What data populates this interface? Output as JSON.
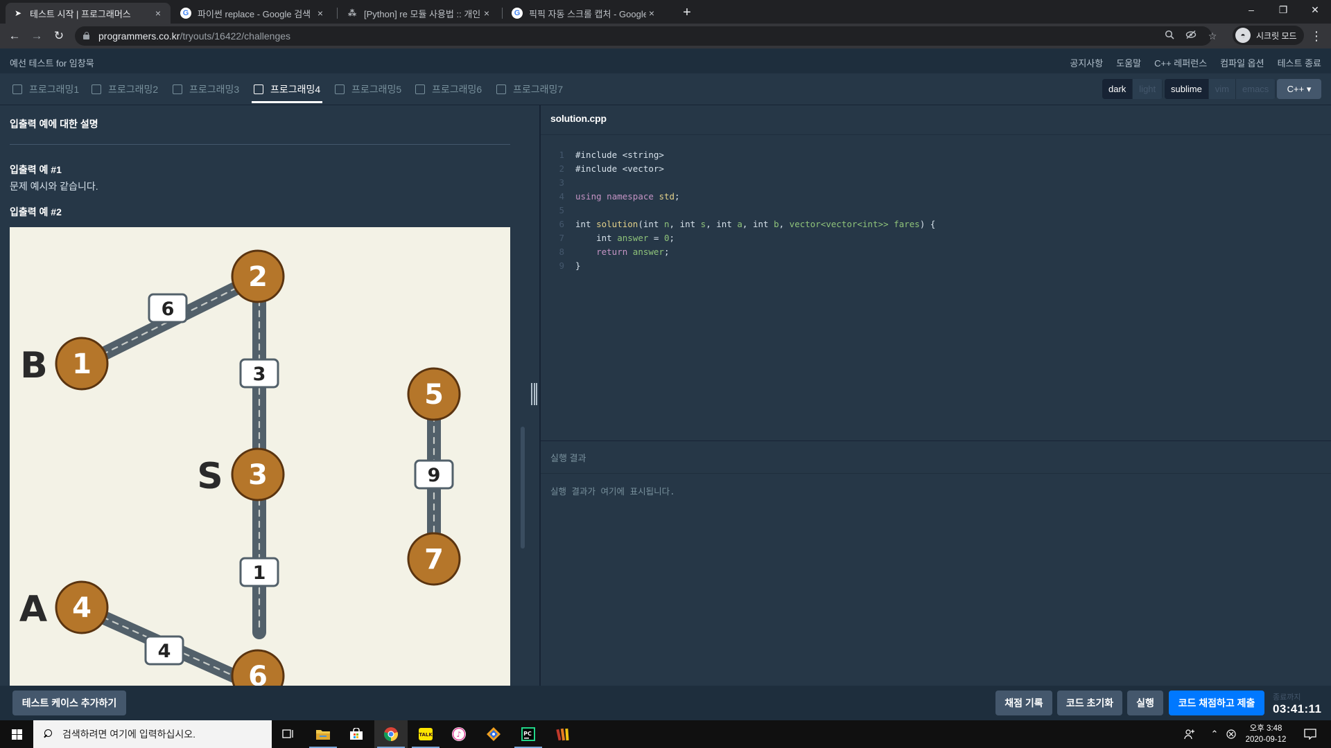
{
  "browser": {
    "tabs": [
      {
        "title": "테스트 시작 | 프로그래머스",
        "active": true
      },
      {
        "title": "파이썬 replace - Google 검색",
        "active": false
      },
      {
        "title": "[Python] re 모듈 사용법 :: 개인적",
        "active": false
      },
      {
        "title": "픽픽 자동 스크롤 캡처 - Google",
        "active": false
      }
    ],
    "close_glyph": "×",
    "new_tab_glyph": "+",
    "url_host": "programmers.co.kr",
    "url_path": "/tryouts/16422/challenges",
    "profile_label": "시크릿 모드",
    "window_controls": {
      "minimize": "–",
      "restore": "❐",
      "close": "✕"
    }
  },
  "header": {
    "test_title": "예선 테스트 for 임창묵",
    "menu": [
      "공지사항",
      "도움말",
      "C++ 레퍼런스",
      "컴파일 옵션",
      "테스트 종료"
    ]
  },
  "problem_tabs": {
    "items": [
      "프로그래밍1",
      "프로그래밍2",
      "프로그래밍3",
      "프로그래밍4",
      "프로그래밍5",
      "프로그래밍6",
      "프로그래밍7"
    ],
    "active_index": 3
  },
  "editor_options": {
    "themes": [
      "dark",
      "light"
    ],
    "selected_theme": "dark",
    "keymaps": [
      "sublime",
      "vim",
      "emacs"
    ],
    "selected_keymap": "sublime",
    "language": "C++"
  },
  "description": {
    "title": "입출력 예에 대한 설명",
    "example1_heading": "입출력 예 #1",
    "example1_text": "문제 예시와 같습니다.",
    "example2_heading": "입출력 예 #2",
    "figure": {
      "nodes": [
        "2",
        "1",
        "3",
        "5",
        "7",
        "4",
        "6"
      ],
      "edge_weights": [
        "6",
        "3",
        "9",
        "1",
        "4"
      ],
      "labels": [
        "B",
        "S",
        "A"
      ]
    }
  },
  "editor": {
    "filename": "solution.cpp",
    "lines": [
      "1",
      "2",
      "3",
      "4",
      "5",
      "6",
      "7",
      "8",
      "9"
    ],
    "code": {
      "l1": "#include <string>",
      "l2": "#include <vector>",
      "l4_kw1": "using",
      "l4_kw2": "namespace",
      "l4_ns": "std",
      "l4_end": ";",
      "l6_int": "int",
      "l6_fn": "solution",
      "l6_paren": "(",
      "l6_p1t": "int",
      "l6_p1": "n",
      "l6_p2t": "int",
      "l6_p2": "s",
      "l6_p3t": "int",
      "l6_p3": "a",
      "l6_p4t": "int",
      "l6_p4": "b",
      "l6_vec": "vector<vector<int>>",
      "l6_fares": "fares",
      "l6_end": ") {",
      "l7_int": "int",
      "l7_var": "answer",
      "l7_assign": " = ",
      "l7_val": "0",
      "l7_end": ";",
      "l8_kw": "return",
      "l8_var": "answer",
      "l8_end": ";",
      "l9": "}"
    }
  },
  "result": {
    "title": "실행 결과",
    "placeholder": "실행 결과가 여기에 표시됩니다."
  },
  "bottom": {
    "add_testcase": "테스트 케이스 추가하기",
    "history": "채점 기록",
    "reset": "코드 초기화",
    "run": "실행",
    "submit": "코드 채점하고 제출",
    "remaining_label": "종료까지",
    "remaining_time": "03:41:11"
  },
  "taskbar": {
    "search_placeholder": "검색하려면 여기에 입력하십시오.",
    "time": "오후 3:48",
    "date": "2020-09-12"
  },
  "colors": {
    "bg": "#263747",
    "header": "#1e2e3d",
    "primary": "#0078ff",
    "node_fill": "#b5762a",
    "road": "#52606a",
    "figure_bg": "#f3f2e6"
  }
}
